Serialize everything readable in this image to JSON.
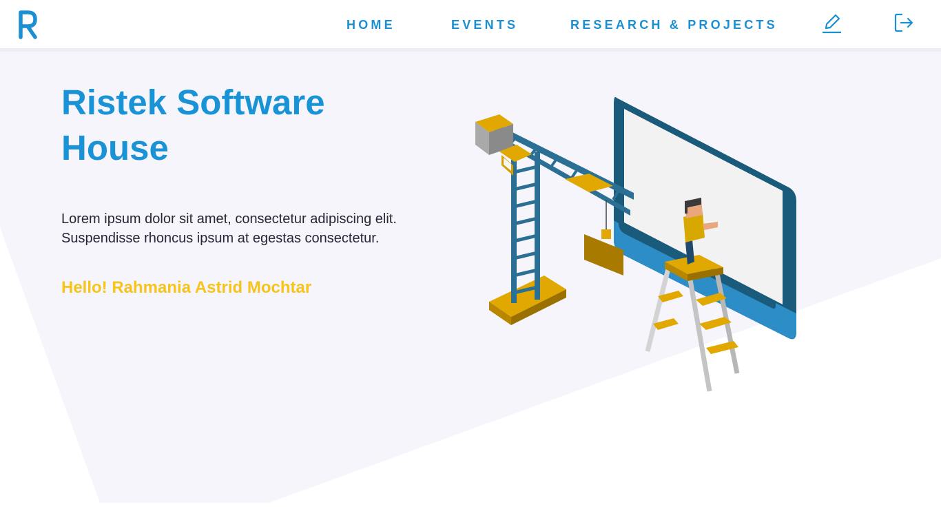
{
  "header": {
    "logo_letter": "R",
    "nav": [
      {
        "label": "HOME"
      },
      {
        "label": "EVENTS"
      },
      {
        "label": "RESEARCH & PROJECTS"
      }
    ],
    "icons": [
      "edit-icon",
      "logout-icon"
    ]
  },
  "hero": {
    "title": "Ristek Software House",
    "description": "Lorem ipsum dolor sit amet, consectetur adipiscing elit. Suspendisse rhoncus ipsum at egestas consectetur.",
    "greeting": "Hello! Rahmania Astrid Mochtar"
  },
  "colors": {
    "brand_blue": "#1a8fd4",
    "title_blue": "#1a93d6",
    "greeting_yellow": "#f7c41b",
    "hero_background": "#f5f5fb"
  }
}
